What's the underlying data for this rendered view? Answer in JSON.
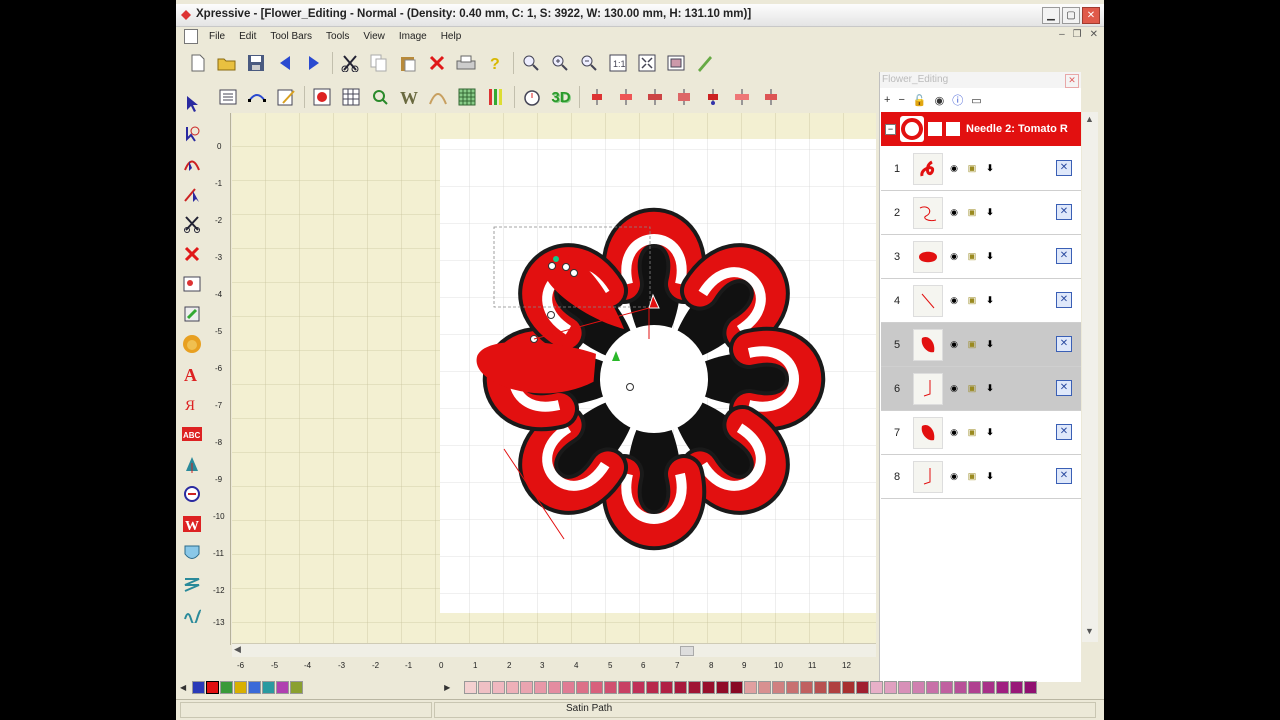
{
  "window": {
    "title": "Xpressive - [Flower_Editing - Normal -  (Density: 0.40 mm, C: 1, S: 3922, W: 130.00 mm, H: 131.10 mm)]"
  },
  "menu": [
    "File",
    "Edit",
    "Tool Bars",
    "Tools",
    "View",
    "Image",
    "Help"
  ],
  "toolbar1": [
    {
      "name": "new-icon"
    },
    {
      "name": "open-icon"
    },
    {
      "name": "save-icon"
    },
    {
      "name": "back-arrow-icon"
    },
    {
      "name": "forward-arrow-icon"
    },
    {
      "name": "cut-icon"
    },
    {
      "name": "copy-icon"
    },
    {
      "name": "paste-icon"
    },
    {
      "name": "delete-icon"
    },
    {
      "name": "print-icon"
    },
    {
      "name": "help-icon"
    },
    {
      "name": "zoom-icon"
    },
    {
      "name": "zoom-in-icon"
    },
    {
      "name": "zoom-out-icon"
    },
    {
      "name": "zoom-1-1-icon"
    },
    {
      "name": "fit-icon"
    },
    {
      "name": "frame-icon"
    },
    {
      "name": "pencil-icon"
    }
  ],
  "toolbar2": [
    {
      "name": "list-icon"
    },
    {
      "name": "node-edit-icon"
    },
    {
      "name": "properties-icon"
    },
    {
      "name": "color-picker-icon"
    },
    {
      "name": "grid-icon"
    },
    {
      "name": "magnify-icon"
    },
    {
      "name": "stitch-w-icon"
    },
    {
      "name": "arc-icon"
    },
    {
      "name": "hoop-grid-icon"
    },
    {
      "name": "thread-icon"
    },
    {
      "name": "stopwatch-icon"
    },
    {
      "name": "3d-icon",
      "label": "3D"
    },
    {
      "name": "needle-1-icon"
    },
    {
      "name": "needle-2-icon"
    },
    {
      "name": "needle-3-icon"
    },
    {
      "name": "needle-4-icon"
    },
    {
      "name": "needle-5-icon"
    },
    {
      "name": "needle-6-icon"
    },
    {
      "name": "needle-7-icon"
    }
  ],
  "lefttools": [
    {
      "name": "select-arrow-icon"
    },
    {
      "name": "rotate-select-icon"
    },
    {
      "name": "node-tool-icon"
    },
    {
      "name": "point-tool-icon"
    },
    {
      "name": "scissors-icon"
    },
    {
      "name": "delete-node-icon"
    },
    {
      "name": "image-tool-icon"
    },
    {
      "name": "paint-tool-icon"
    },
    {
      "name": "lion-icon"
    },
    {
      "name": "lettering-a-icon"
    },
    {
      "name": "monogram-icon"
    },
    {
      "name": "abc-icon"
    },
    {
      "name": "fill-arrow-icon"
    },
    {
      "name": "run-tool-icon"
    },
    {
      "name": "satin-w-icon"
    },
    {
      "name": "shield-icon"
    },
    {
      "name": "zigzag-icon"
    },
    {
      "name": "squiggle-icon"
    }
  ],
  "panel": {
    "title": "Flower_Editing",
    "needle_label": "Needle 2: Tomato R",
    "rows": [
      {
        "num": "1",
        "thumb": "swirl-red"
      },
      {
        "num": "2",
        "thumb": "line-loop"
      },
      {
        "num": "3",
        "thumb": "petal-red"
      },
      {
        "num": "4",
        "thumb": "line-diag"
      },
      {
        "num": "5",
        "thumb": "petal-red-stitch",
        "selected": true
      },
      {
        "num": "6",
        "thumb": "line-hook",
        "selected": true
      },
      {
        "num": "7",
        "thumb": "petal-red-stitch"
      },
      {
        "num": "8",
        "thumb": "line-hook"
      }
    ]
  },
  "ruler": {
    "h": [
      "-6",
      "-5",
      "-4",
      "-3",
      "-2",
      "-1",
      "0",
      "1",
      "2",
      "3",
      "4",
      "5",
      "6",
      "7",
      "8",
      "9",
      "10",
      "11",
      "12"
    ],
    "v": [
      "0",
      "-1",
      "-2",
      "-3",
      "-4",
      "-5",
      "-6",
      "-7",
      "-8",
      "-9",
      "-10",
      "-11",
      "-12",
      "-13"
    ]
  },
  "status": {
    "text": "Satin Path"
  },
  "colors": {
    "accent_red": "#e21010",
    "canvas_bg": "#f3f0d2",
    "design_bg": "#ffffff"
  }
}
